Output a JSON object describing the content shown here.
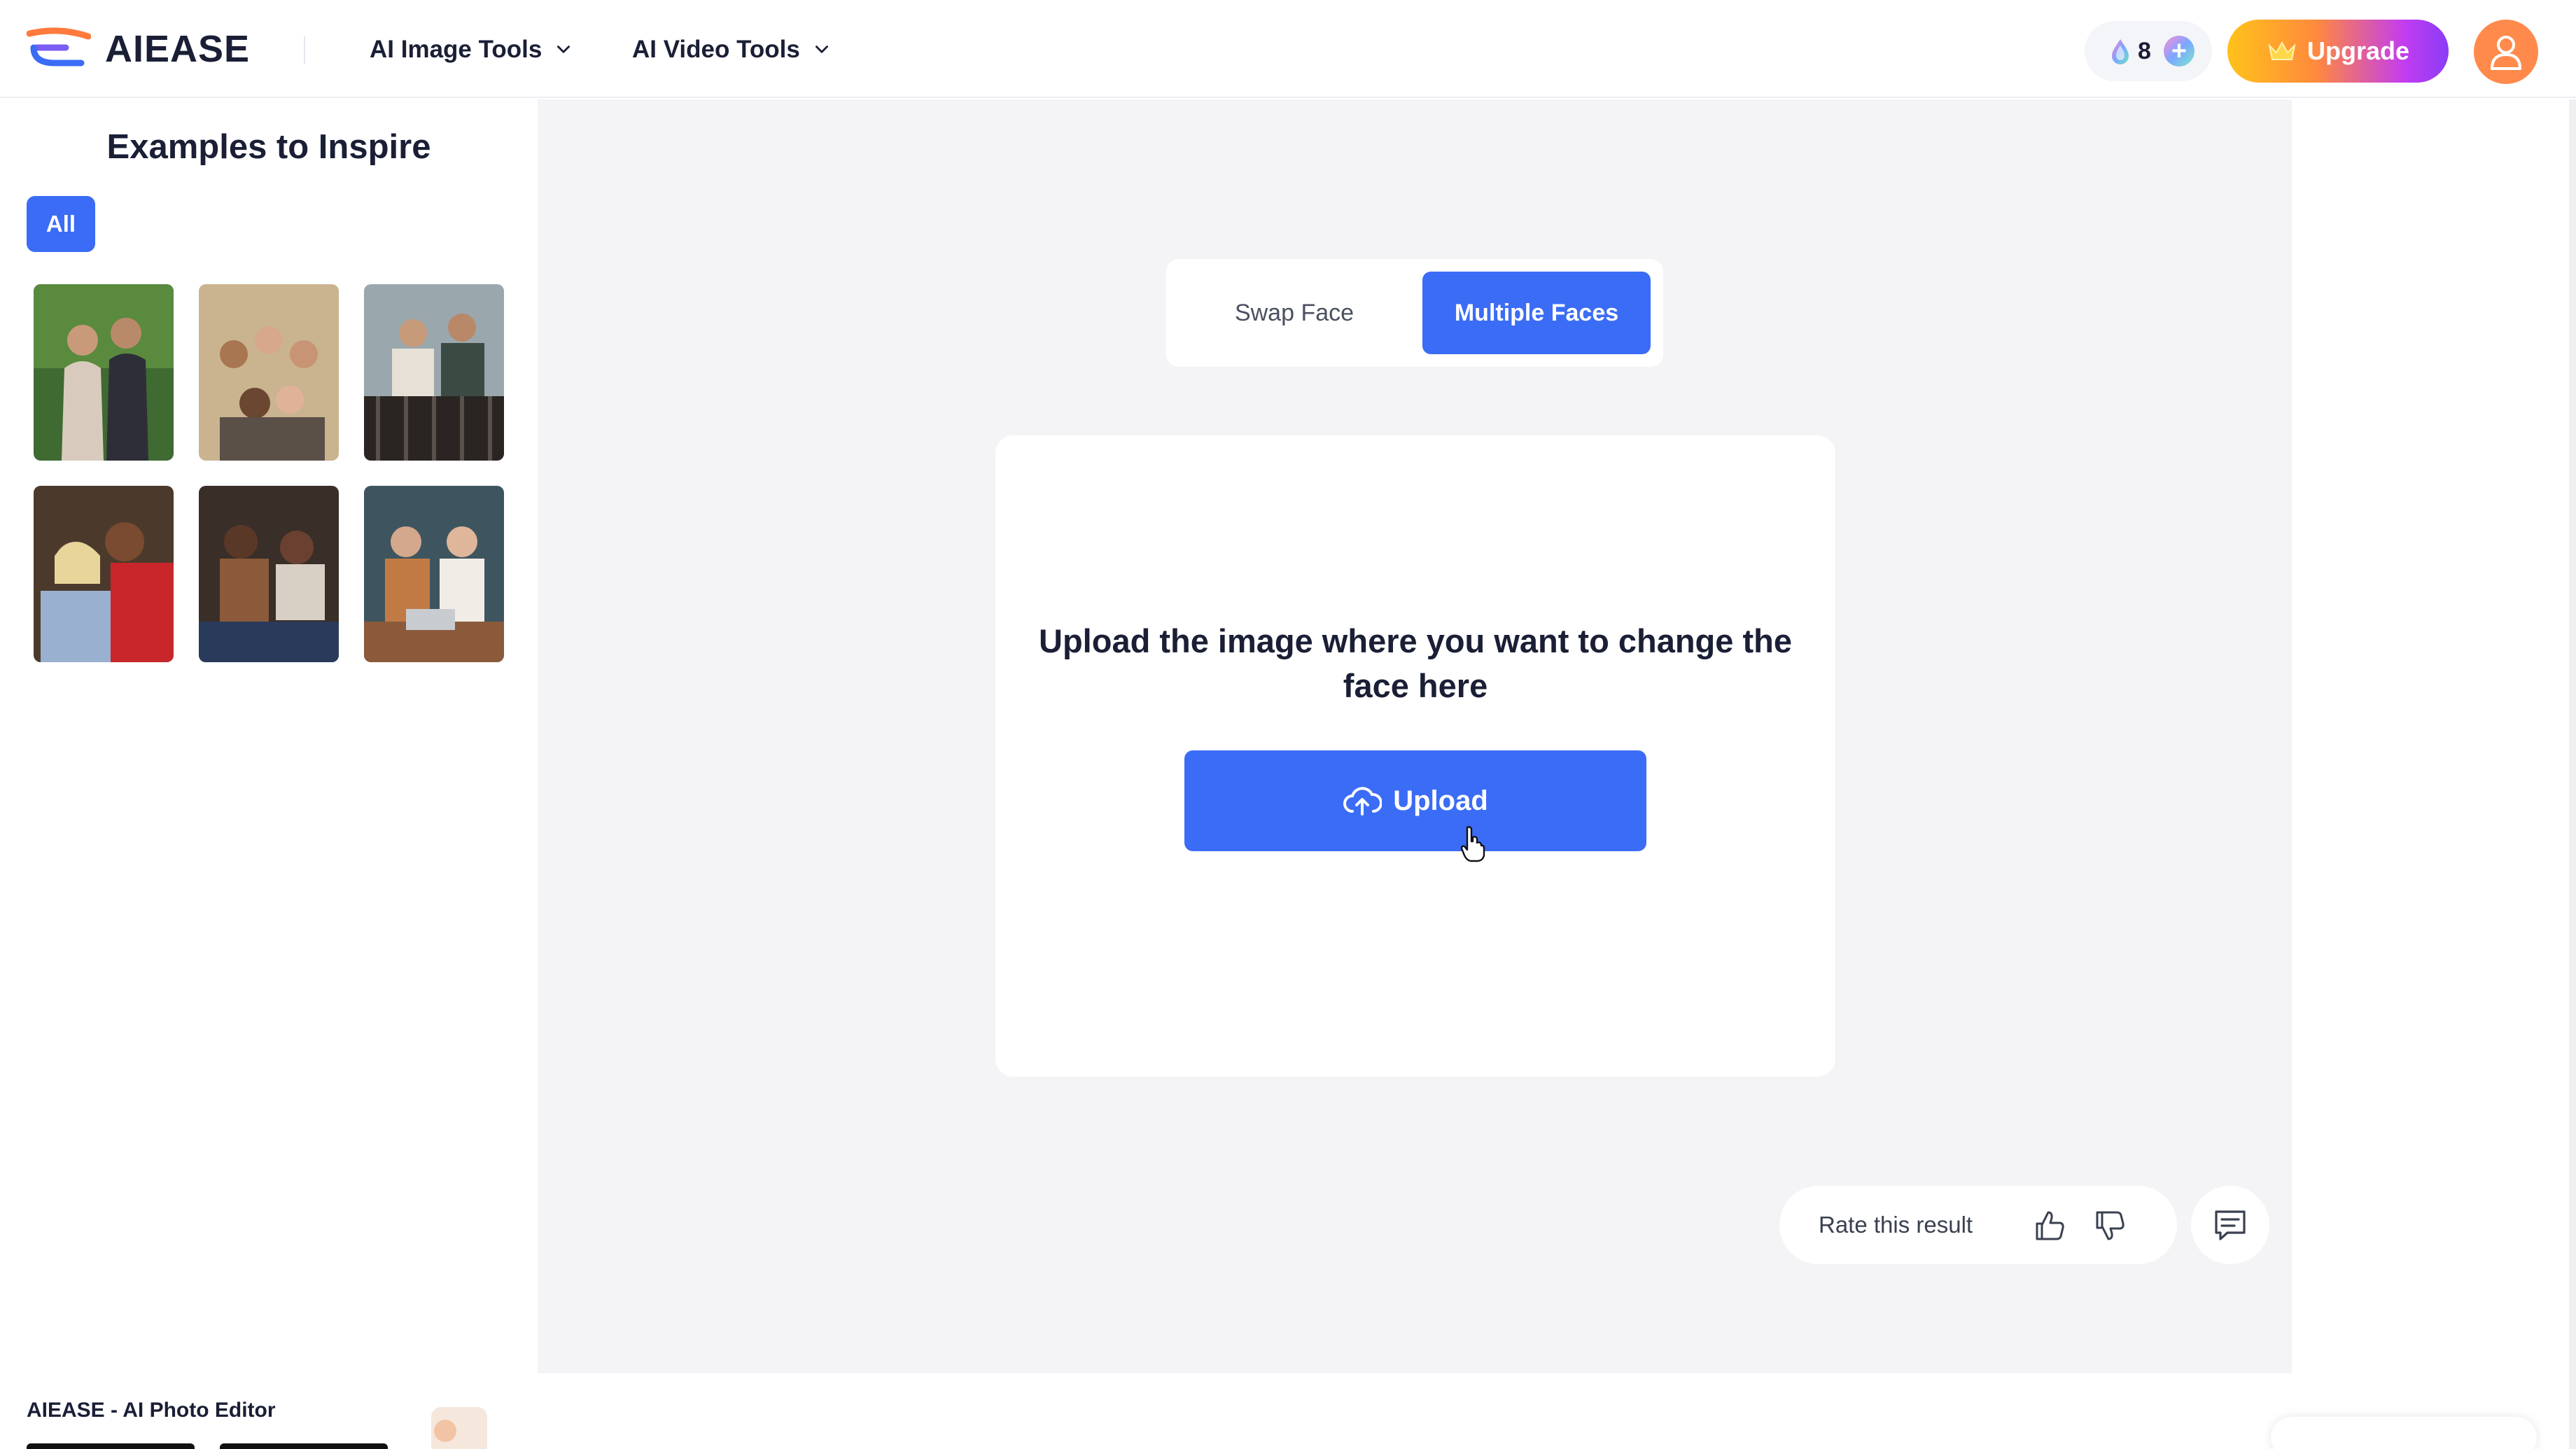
{
  "header": {
    "brand": "AIEASE",
    "nav": [
      {
        "label": "AI Image Tools"
      },
      {
        "label": "AI Video Tools"
      }
    ],
    "credits": "8",
    "upgrade_label": "Upgrade"
  },
  "sidebar": {
    "title": "Examples to Inspire",
    "filter_all": "All",
    "promo_title": "AIEASE - AI Photo Editor"
  },
  "main": {
    "tabs": [
      {
        "label": "Swap Face",
        "active": false
      },
      {
        "label": "Multiple Faces",
        "active": true
      }
    ],
    "upload_prompt": "Upload the image where you want to change the face here",
    "upload_label": "Upload",
    "rate_label": "Rate this result"
  },
  "colors": {
    "accent": "#3b6cf6",
    "background": "#f4f4f6",
    "avatar": "#ff8a4c"
  }
}
